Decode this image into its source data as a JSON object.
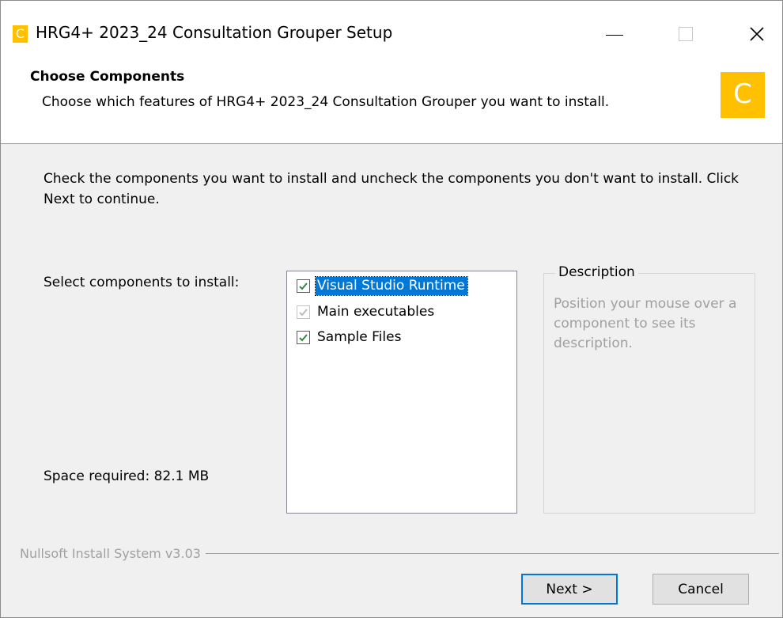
{
  "window": {
    "title": "HRG4+ 2023_24 Consultation Grouper Setup",
    "app_icon_letter": "C",
    "controls": [
      "minimize-icon",
      "maximize-icon",
      "close-icon"
    ],
    "close_glyph": "✕"
  },
  "header": {
    "title": "Choose Components",
    "subtitle": "Choose which features of HRG4+ 2023_24 Consultation Grouper you want to install.",
    "logo_letter": "C",
    "logo_color": "#ffc000"
  },
  "main": {
    "instruction": "Check the components you want to install and uncheck the components you don't want to install. Click Next to continue.",
    "select_label": "Select components to install:",
    "space_required": "Space required: 82.1 MB",
    "components": [
      {
        "label": "Visual Studio Runtime",
        "checked": true,
        "disabled": false,
        "selected": true
      },
      {
        "label": "Main executables",
        "checked": true,
        "disabled": true,
        "selected": false
      },
      {
        "label": "Sample Files",
        "checked": true,
        "disabled": false,
        "selected": false
      }
    ],
    "description": {
      "legend": "Description",
      "text": "Position your mouse over a component to see its description."
    }
  },
  "footer": {
    "branding": "Nullsoft Install System v3.03",
    "next_label": "Next >",
    "cancel_label": "Cancel"
  },
  "colors": {
    "accent": "#0078d7",
    "check_enabled": "#2e8b3e",
    "check_disabled": "#bcbcbc",
    "brand": "#ffc000"
  }
}
